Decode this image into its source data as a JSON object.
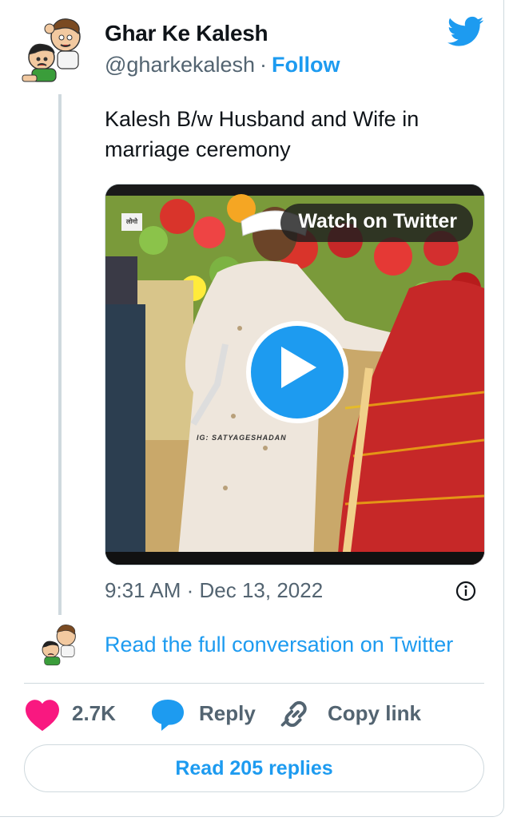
{
  "colors": {
    "accent": "#1d9bf0",
    "heart": "#f91880",
    "muted": "#536471"
  },
  "author": {
    "display_name": "Ghar Ke Kalesh",
    "handle": "@gharkekalesh",
    "separator": "·",
    "follow_label": "Follow",
    "avatar_icon": "cartoon-fighting-kids-avatar"
  },
  "tweet": {
    "text": "Kalesh B/w Husband and Wife in marriage ceremony",
    "timestamp": "9:31 AM · Dec 13, 2022"
  },
  "media": {
    "watch_label": "Watch on Twitter",
    "play_icon": "play-icon",
    "watermark": "IG: SATYAGESHADAN"
  },
  "conversation": {
    "read_full_label": "Read the full conversation on Twitter"
  },
  "actions": {
    "likes": "2.7K",
    "reply_label": "Reply",
    "copy_link_label": "Copy link"
  },
  "replies": {
    "read_replies_label": "Read 205 replies"
  },
  "icons": [
    "twitter-logo-icon",
    "info-icon",
    "heart-icon",
    "reply-bubble-icon",
    "link-icon"
  ]
}
